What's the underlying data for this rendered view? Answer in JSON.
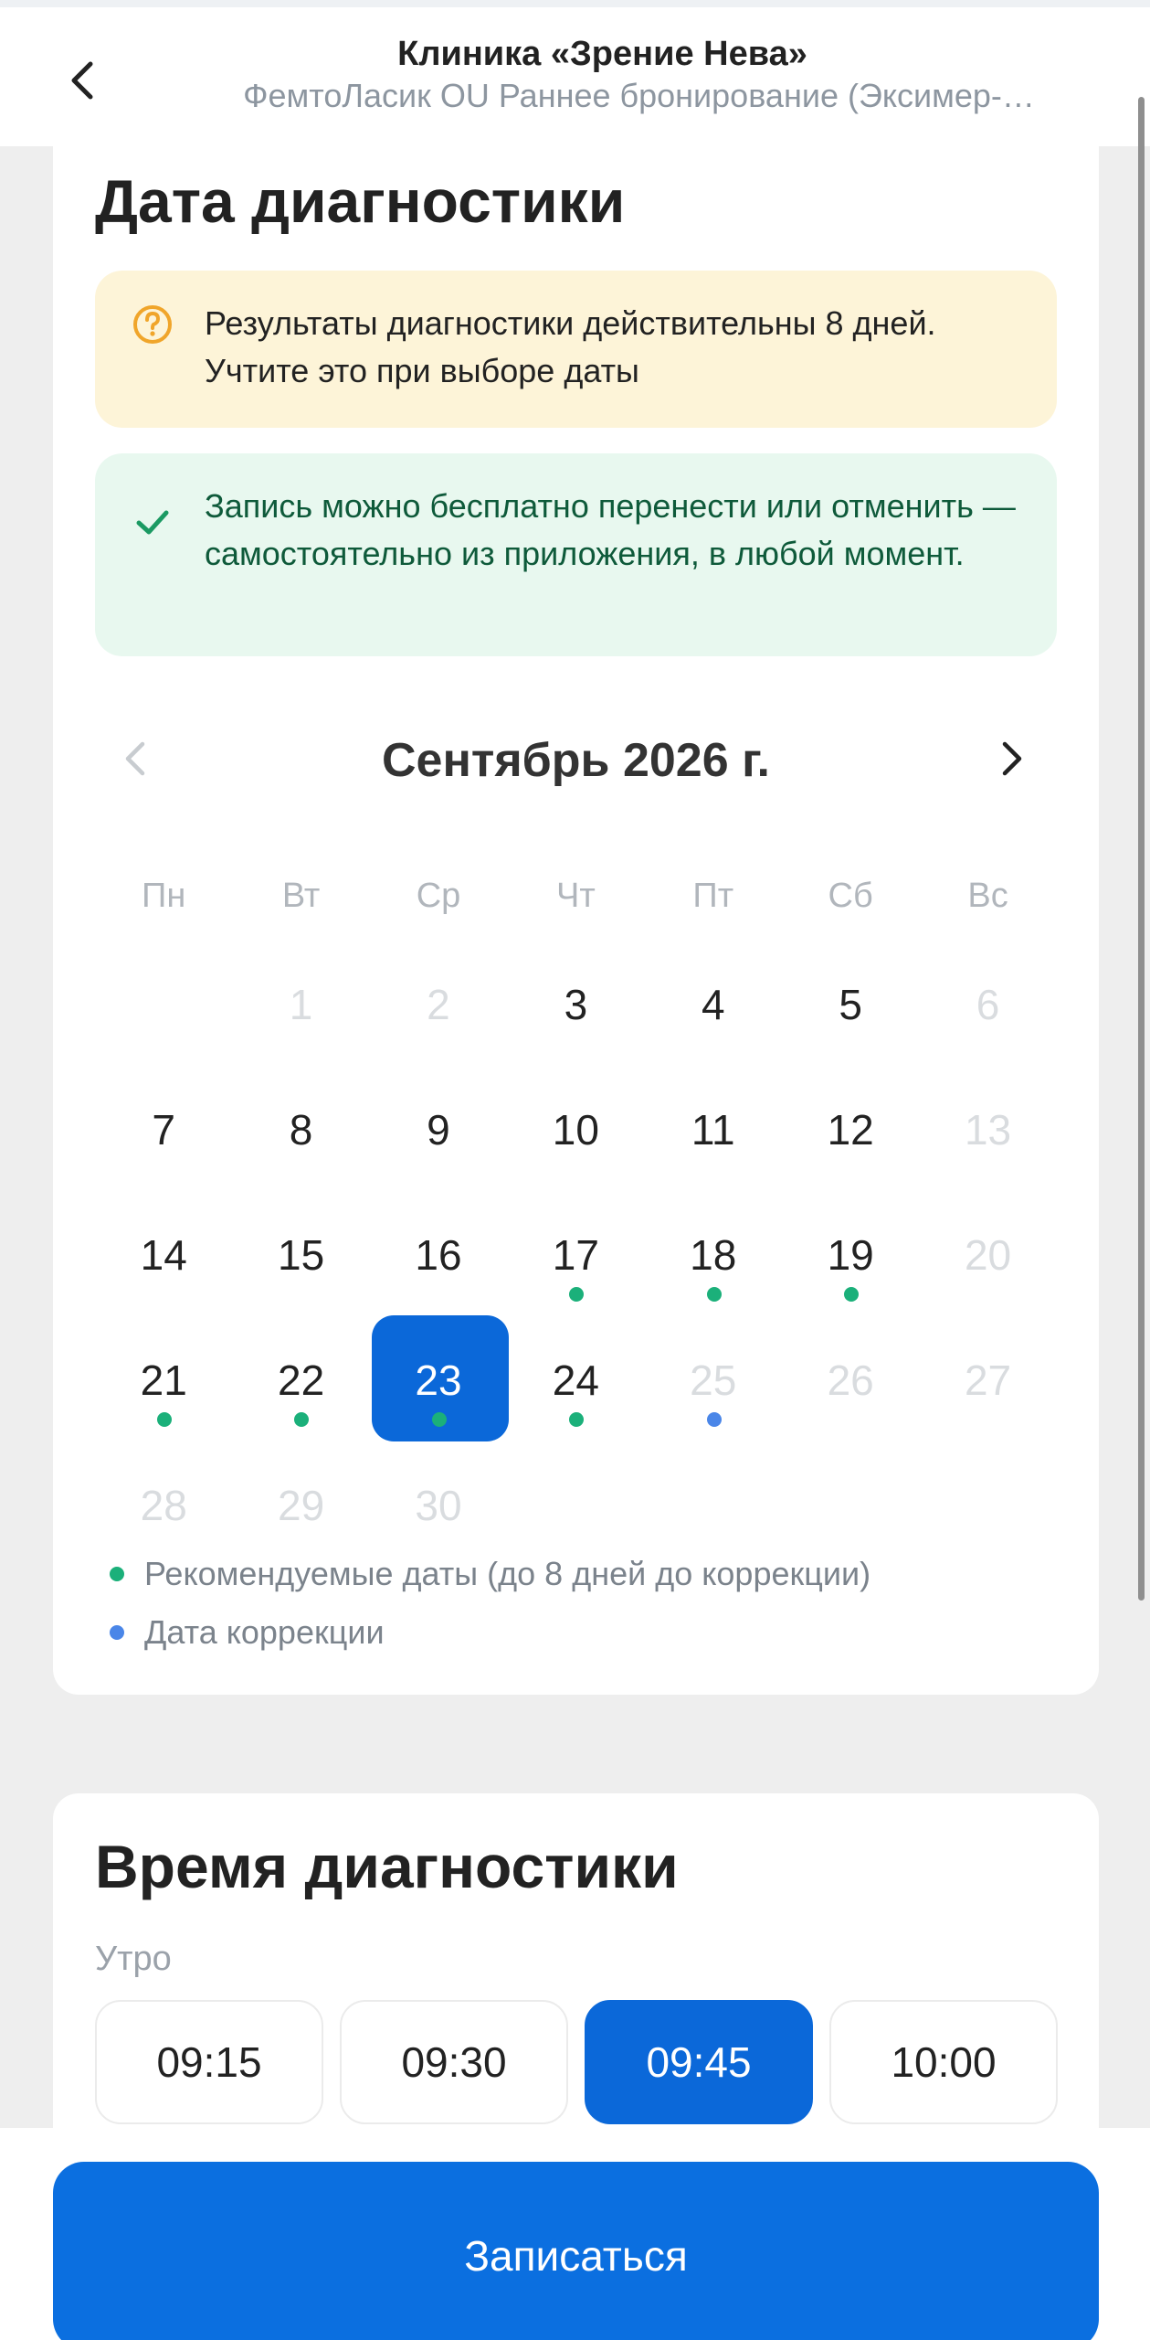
{
  "header": {
    "title": "Клиника «Зрение Нева»",
    "subtitle": "ФемтоЛасик OU Раннее бронирование (Эксимер-…"
  },
  "date_section": {
    "title": "Дата диагностики",
    "warning_notice": "Результаты диагностики действительны 8 дней. Учтите это при выборе даты",
    "info_notice": "Запись можно бесплатно перенести или отменить — самостоятельно из приложения, в любой момент.",
    "month_label": "Сентябрь 2026 г.",
    "weekdays": [
      "Пн",
      "Вт",
      "Ср",
      "Чт",
      "Пт",
      "Сб",
      "Вс"
    ],
    "weeks": [
      [
        {
          "label": "",
          "state": "empty"
        },
        {
          "label": "1",
          "state": "disabled"
        },
        {
          "label": "2",
          "state": "disabled"
        },
        {
          "label": "3",
          "state": "enabled"
        },
        {
          "label": "4",
          "state": "enabled"
        },
        {
          "label": "5",
          "state": "enabled"
        },
        {
          "label": "6",
          "state": "disabled"
        }
      ],
      [
        {
          "label": "7",
          "state": "enabled"
        },
        {
          "label": "8",
          "state": "enabled"
        },
        {
          "label": "9",
          "state": "enabled"
        },
        {
          "label": "10",
          "state": "enabled"
        },
        {
          "label": "11",
          "state": "enabled"
        },
        {
          "label": "12",
          "state": "enabled"
        },
        {
          "label": "13",
          "state": "disabled"
        }
      ],
      [
        {
          "label": "14",
          "state": "enabled"
        },
        {
          "label": "15",
          "state": "enabled"
        },
        {
          "label": "16",
          "state": "enabled"
        },
        {
          "label": "17",
          "state": "enabled",
          "dot": "recommended"
        },
        {
          "label": "18",
          "state": "enabled",
          "dot": "recommended"
        },
        {
          "label": "19",
          "state": "enabled",
          "dot": "recommended"
        },
        {
          "label": "20",
          "state": "disabled"
        }
      ],
      [
        {
          "label": "21",
          "state": "enabled",
          "dot": "recommended"
        },
        {
          "label": "22",
          "state": "enabled",
          "dot": "recommended"
        },
        {
          "label": "23",
          "state": "selected",
          "dot": "recommended"
        },
        {
          "label": "24",
          "state": "enabled",
          "dot": "recommended"
        },
        {
          "label": "25",
          "state": "disabled",
          "dot": "correction"
        },
        {
          "label": "26",
          "state": "disabled"
        },
        {
          "label": "27",
          "state": "disabled"
        }
      ],
      [
        {
          "label": "28",
          "state": "disabled"
        },
        {
          "label": "29",
          "state": "disabled"
        },
        {
          "label": "30",
          "state": "disabled"
        },
        {
          "label": "",
          "state": "empty"
        },
        {
          "label": "",
          "state": "empty"
        },
        {
          "label": "",
          "state": "empty"
        },
        {
          "label": "",
          "state": "empty"
        }
      ]
    ],
    "legend": [
      {
        "label": "Рекомендуемые даты (до 8 дней до коррекции)",
        "color": "#1bb07a"
      },
      {
        "label": "Дата коррекции",
        "color": "#4a86e8"
      }
    ]
  },
  "time_section": {
    "title": "Время диагностики",
    "period_label": "Утро",
    "slots": [
      {
        "label": "09:15",
        "selected": false
      },
      {
        "label": "09:30",
        "selected": false
      },
      {
        "label": "09:45",
        "selected": true
      },
      {
        "label": "10:00",
        "selected": false
      }
    ]
  },
  "cta": {
    "label": "Записаться"
  },
  "colors": {
    "accent": "#0b68d9",
    "recommended_dot": "#1bb07a",
    "correction_dot": "#4a86e8",
    "warning_bg": "#fdf4d8",
    "success_bg": "#e8f8ef"
  }
}
